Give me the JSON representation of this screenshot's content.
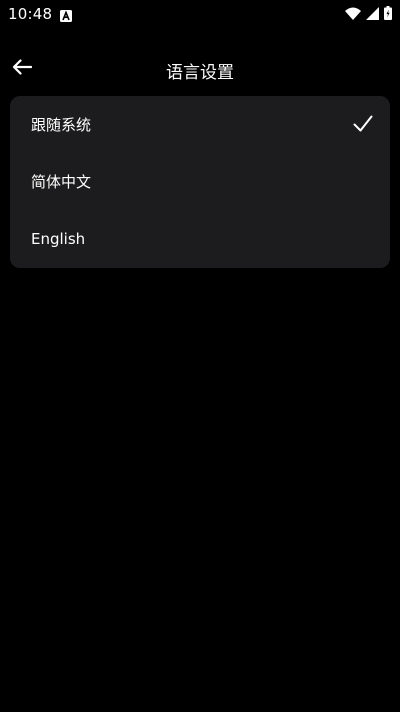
{
  "status_bar": {
    "time": "10:48",
    "icons": [
      "a-notification-icon",
      "wifi-icon",
      "signal-icon",
      "battery-charging-icon"
    ]
  },
  "header": {
    "title": "语言设置",
    "back_icon": "arrow-left-icon"
  },
  "language_options": [
    {
      "label": "跟随系统",
      "selected": true
    },
    {
      "label": "简体中文",
      "selected": false
    },
    {
      "label": "English",
      "selected": false
    }
  ],
  "colors": {
    "background": "#000000",
    "card": "#1c1c1e",
    "text": "#ffffff"
  }
}
